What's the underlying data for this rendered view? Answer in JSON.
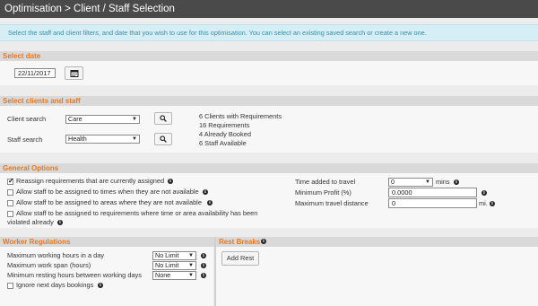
{
  "page": {
    "title": "Optimisation > Client / Staff Selection",
    "info_message": "Select the staff and client filters, and date that you wish to use for this optimisation. You can select an existing saved search or create a new one."
  },
  "select_date": {
    "heading": "Select date",
    "date_value": "22/11/2017",
    "calendar_icon": "calendar-icon"
  },
  "clients_staff": {
    "heading": "Select clients and staff",
    "client_search_label": "Client search",
    "client_search_value": "Care",
    "staff_search_label": "Staff search",
    "staff_search_value": "Health",
    "search_icon": "magnifier-icon",
    "stats": [
      "6 Clients with Requirements",
      "16 Requirements",
      "4 Already Booked",
      "6 Staff Available"
    ]
  },
  "general_options": {
    "heading": "General Options",
    "reassign": {
      "label": "Reassign requirements that are currently assigned",
      "checked": true
    },
    "allow_times": {
      "label": "Allow staff to be assigned to times when they are not available",
      "checked": false
    },
    "allow_areas": {
      "label": "Allow staff to be assigned to areas where they are not available",
      "checked": false
    },
    "allow_requirements": {
      "label_line1": "Allow staff to be assigned to requirements where time or area availability has been",
      "label_line2": "violated already",
      "checked": false
    },
    "travel_time_label": "Time added to travel",
    "travel_time_value": "0",
    "travel_time_unit": "mins",
    "min_profit_label": "Minimum Profit (%)",
    "min_profit_value": "0.0000",
    "max_travel_label": "Maximum travel distance",
    "max_travel_value": "0",
    "max_travel_unit": "mi."
  },
  "worker_regulations": {
    "heading": "Worker Regulations",
    "max_hours_label": "Maximum working hours in a day",
    "max_hours_value": "No Limit",
    "max_span_label": "Maximum work span (hours)",
    "max_span_value": "No Limit",
    "min_rest_label": "Minimum resting hours between working days",
    "min_rest_value": "None",
    "ignore_next_label": "Ignore next days bookings"
  },
  "rest_breaks": {
    "heading": "Rest Breaks",
    "add_rest_label": "Add Rest"
  },
  "colors": {
    "title_bar": "#4a4a4a",
    "accent": "#e87722",
    "info_bg": "#d6eef5",
    "info_text": "#3a8eaa"
  }
}
